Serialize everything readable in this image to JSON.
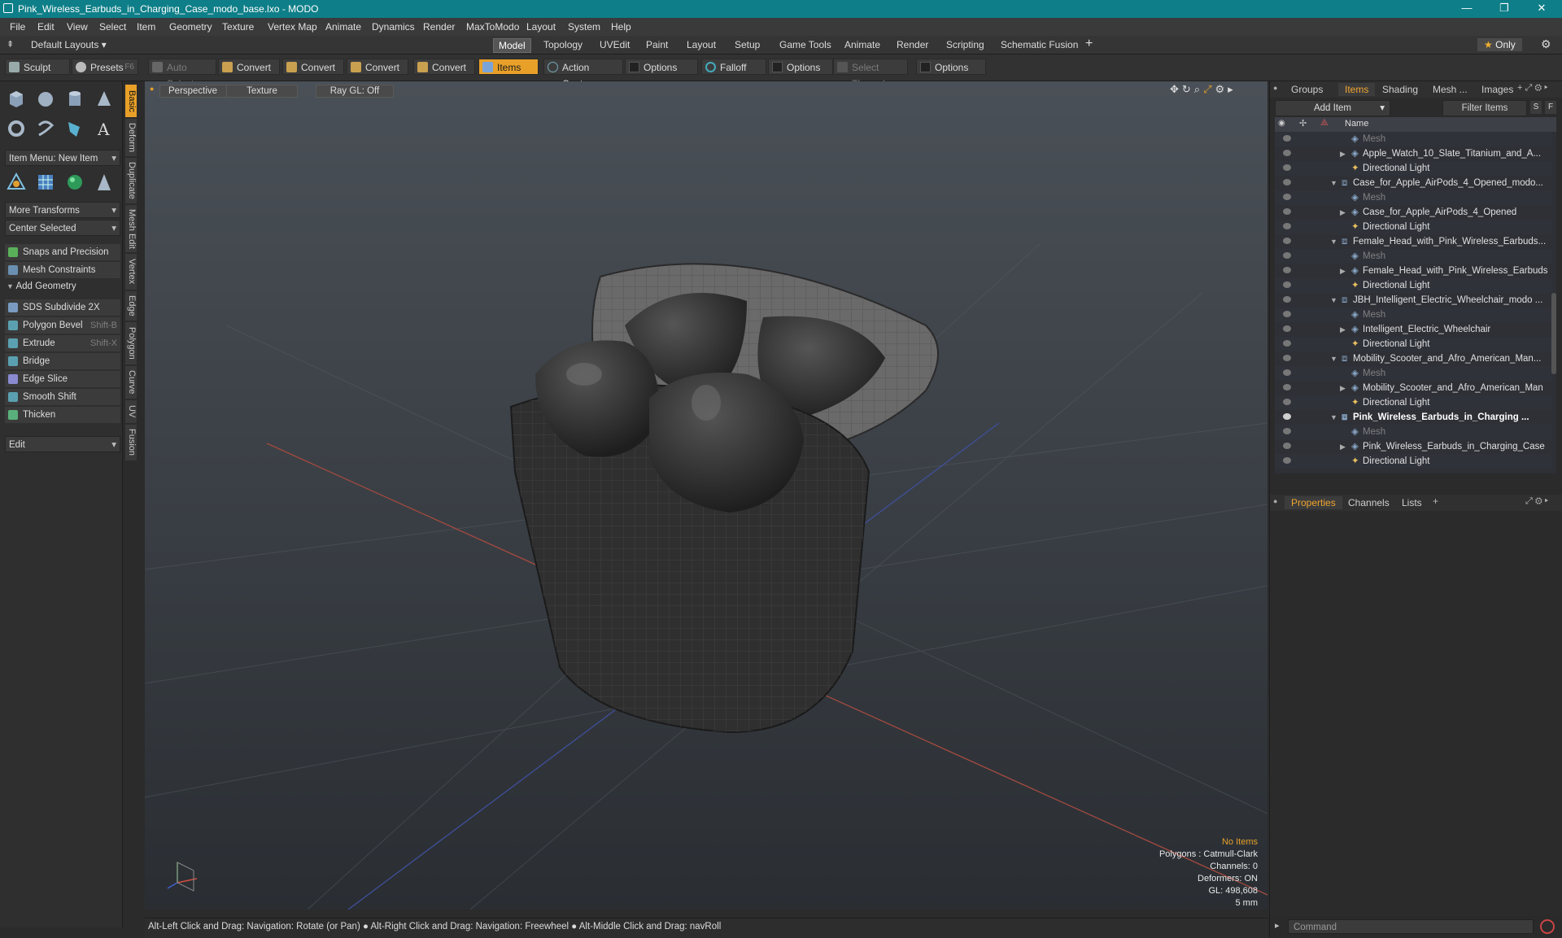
{
  "window": {
    "title": "Pink_Wireless_Earbuds_in_Charging_Case_modo_base.lxo - MODO"
  },
  "menu": [
    "File",
    "Edit",
    "View",
    "Select",
    "Item",
    "Geometry",
    "Texture",
    "Vertex Map",
    "Animate",
    "Dynamics",
    "Render",
    "MaxToModo",
    "Layout",
    "System",
    "Help"
  ],
  "layout": {
    "default_layouts": "Default Layouts",
    "tabs": [
      "Model",
      "Topology",
      "UVEdit",
      "Paint",
      "Layout",
      "Setup",
      "Game Tools",
      "Animate",
      "Render",
      "Scripting",
      "Schematic Fusion"
    ],
    "active_tab": "Model",
    "only_label": "Only"
  },
  "toolbar": {
    "sculpt": "Sculpt",
    "presets": "Presets",
    "presets_shortcut": "F6",
    "auto_select": "Auto Select",
    "convert1": "Convert",
    "convert2": "Convert",
    "convert3": "Convert",
    "convert4": "Convert",
    "items": "Items",
    "action_center": "Action Center",
    "options1": "Options",
    "falloff": "Falloff",
    "options2": "Options",
    "select_through": "Select Through",
    "options3": "Options"
  },
  "left": {
    "item_menu": "Item Menu: New Item",
    "more_transforms": "More Transforms",
    "center_selected": "Center Selected",
    "snaps": "Snaps and Precision",
    "mesh_constraints": "Mesh Constraints",
    "add_geometry": "Add Geometry",
    "tools": [
      {
        "label": "SDS Subdivide 2X",
        "shortcut": ""
      },
      {
        "label": "Polygon Bevel",
        "shortcut": "Shift-B"
      },
      {
        "label": "Extrude",
        "shortcut": "Shift-X"
      },
      {
        "label": "Bridge",
        "shortcut": ""
      },
      {
        "label": "Edge Slice",
        "shortcut": ""
      },
      {
        "label": "Smooth Shift",
        "shortcut": ""
      },
      {
        "label": "Thicken",
        "shortcut": ""
      }
    ],
    "edit": "Edit",
    "vtabs": [
      "Basic",
      "Deform",
      "Duplicate",
      "Mesh Edit",
      "Vertex",
      "Edge",
      "Polygon",
      "Curve",
      "UV",
      "Fusion"
    ]
  },
  "viewport": {
    "tabs": [
      "Perspective",
      "Texture",
      "Ray GL: Off"
    ],
    "hud": {
      "selection": "No Items",
      "polygons": "Polygons : Catmull-Clark",
      "channels": "Channels: 0",
      "deformers": "Deformers: ON",
      "gl": "GL: 498,608",
      "scale": "5 mm"
    }
  },
  "status": {
    "hint1": "Alt-Left Click and Drag: Navigation: Rotate (or Pan)",
    "hint2": "Alt-Right Click and Drag: Navigation: Freewheel",
    "hint3": "Alt-Middle Click and Drag: navRoll"
  },
  "right": {
    "tabs": [
      "Groups",
      "Items",
      "Shading",
      "Mesh ...",
      "Images"
    ],
    "active_tab": "Items",
    "add_item": "Add Item",
    "filter": "Filter Items",
    "col_name": "Name",
    "tree": [
      {
        "label": "Mesh",
        "indent": 2,
        "dim": true
      },
      {
        "label": "Apple_Watch_10_Slate_Titanium_and_A...",
        "indent": 2,
        "expand": true
      },
      {
        "label": "Directional Light",
        "indent": 2
      },
      {
        "label": "Case_for_Apple_AirPods_4_Opened_modo...",
        "indent": 1,
        "expand": true
      },
      {
        "label": "Mesh",
        "indent": 2,
        "dim": true
      },
      {
        "label": "Case_for_Apple_AirPods_4_Opened",
        "indent": 2,
        "expand": true
      },
      {
        "label": "Directional Light",
        "indent": 2
      },
      {
        "label": "Female_Head_with_Pink_Wireless_Earbuds...",
        "indent": 1,
        "expand": true
      },
      {
        "label": "Mesh",
        "indent": 2,
        "dim": true
      },
      {
        "label": "Female_Head_with_Pink_Wireless_Earbuds",
        "indent": 2,
        "expand": true
      },
      {
        "label": "Directional Light",
        "indent": 2
      },
      {
        "label": "JBH_Intelligent_Electric_Wheelchair_modo ...",
        "indent": 1,
        "expand": true
      },
      {
        "label": "Mesh",
        "indent": 2,
        "dim": true
      },
      {
        "label": "Intelligent_Electric_Wheelchair",
        "indent": 2,
        "expand": true
      },
      {
        "label": "Directional Light",
        "indent": 2
      },
      {
        "label": "Mobility_Scooter_and_Afro_American_Man...",
        "indent": 1,
        "expand": true
      },
      {
        "label": "Mesh",
        "indent": 2,
        "dim": true
      },
      {
        "label": "Mobility_Scooter_and_Afro_American_Man",
        "indent": 2,
        "expand": true
      },
      {
        "label": "Directional Light",
        "indent": 2
      },
      {
        "label": "Pink_Wireless_Earbuds_in_Charging ...",
        "indent": 1,
        "expand": true,
        "bold": true
      },
      {
        "label": "Mesh",
        "indent": 2,
        "dim": true
      },
      {
        "label": "Pink_Wireless_Earbuds_in_Charging_Case",
        "indent": 2,
        "expand": true
      },
      {
        "label": "Directional Light",
        "indent": 2
      }
    ],
    "bottom_tabs": [
      "Properties",
      "Channels",
      "Lists"
    ],
    "command_placeholder": "Command"
  },
  "colors": {
    "accent": "#e8a029",
    "titlebar": "#0e7f88"
  }
}
